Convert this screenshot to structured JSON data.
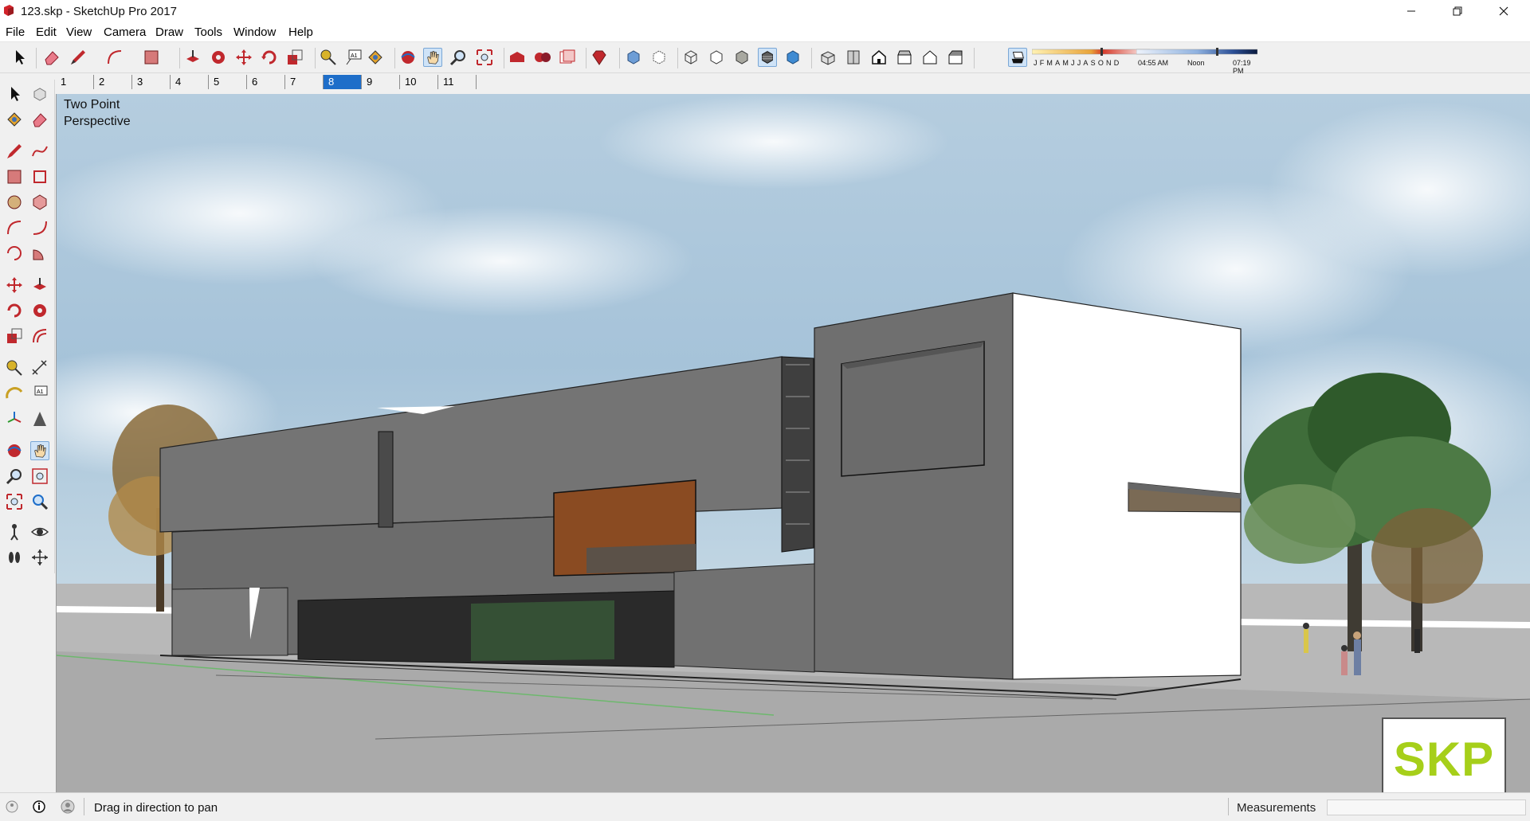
{
  "window": {
    "title": "123.skp - SketchUp Pro 2017",
    "minimize_label": "—",
    "maximize_label": "❐",
    "close_label": "✕"
  },
  "menu": {
    "items": [
      "File",
      "Edit",
      "View",
      "Camera",
      "Draw",
      "Tools",
      "Window",
      "Help"
    ]
  },
  "shadow": {
    "months": [
      "J",
      "F",
      "M",
      "A",
      "M",
      "J",
      "J",
      "A",
      "S",
      "O",
      "N",
      "D"
    ],
    "time_start": "04:55 AM",
    "time_mid": "Noon",
    "time_end": "07:19 PM"
  },
  "scenes": {
    "tabs": [
      "1",
      "2",
      "3",
      "4",
      "5",
      "6",
      "7",
      "8",
      "9",
      "10",
      "11"
    ],
    "active_index": 7
  },
  "viewport": {
    "camera_label_line1": "Two Point",
    "camera_label_line2": "Perspective",
    "logo_text": "SKP"
  },
  "status": {
    "hint": "Drag in direction to pan",
    "measurements_label": "Measurements",
    "measurements_value": ""
  },
  "colors": {
    "accent": "#1e6ec9",
    "skp_logo": "#a6cf1a",
    "icon_red": "#c0282d"
  },
  "toolbar": {
    "icons": [
      "select-icon",
      "eraser-icon",
      "pencil-line-icon",
      "arc-icon",
      "rectangle-icon",
      "push-pull-icon",
      "follow-me-icon",
      "move-icon",
      "rotate-icon",
      "scale-icon",
      "tape-measure-icon",
      "text-icon",
      "paint-bucket-icon",
      "orbit-icon",
      "pan-icon",
      "zoom-icon",
      "zoom-extents-icon",
      "warehouse-icon",
      "extension-warehouse-icon",
      "layout-icon",
      "ruby-icon",
      "xray-icon",
      "back-edges-icon",
      "wireframe-icon",
      "hidden-line-icon",
      "shaded-icon",
      "shaded-textures-icon",
      "monochrome-icon",
      "iso-view-icon",
      "top-view-icon",
      "front-view-icon",
      "right-view-icon",
      "back-view-icon",
      "left-view-icon",
      "shadows-toggle-icon"
    ]
  }
}
